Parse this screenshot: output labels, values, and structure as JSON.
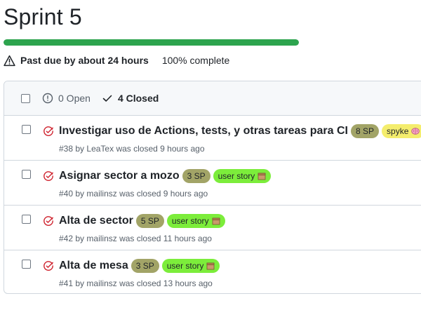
{
  "milestone": {
    "title": "Sprint 5",
    "progress_percent": 100,
    "progress_color": "#2da44e",
    "due_text": "Past due by about 24 hours",
    "complete_text": "100% complete"
  },
  "list_header": {
    "open_text": "0 Open",
    "closed_text": "4 Closed"
  },
  "issues": [
    {
      "title": "Investigar uso de Actions, tests, y otras tareas para CI",
      "labels": [
        {
          "text": "8 SP",
          "bg": "#a2a467",
          "icon": null
        },
        {
          "text": "spyke",
          "bg": "#f4ed6d",
          "icon": "brain-icon"
        }
      ],
      "number": "#38",
      "by": "by",
      "author": "LeaTex",
      "status_text": "was closed 9 hours ago"
    },
    {
      "title": "Asignar sector a mozo",
      "labels": [
        {
          "text": "3 SP",
          "bg": "#a2a467",
          "icon": null
        },
        {
          "text": "user story",
          "bg": "#7ced3b",
          "icon": "box-icon"
        }
      ],
      "number": "#40",
      "by": "by",
      "author": "mailinsz",
      "status_text": "was closed 9 hours ago"
    },
    {
      "title": "Alta de sector",
      "labels": [
        {
          "text": "5 SP",
          "bg": "#a2a467",
          "icon": null
        },
        {
          "text": "user story",
          "bg": "#7ced3b",
          "icon": "box-icon"
        }
      ],
      "number": "#42",
      "by": "by",
      "author": "mailinsz",
      "status_text": "was closed 11 hours ago"
    },
    {
      "title": "Alta de mesa",
      "labels": [
        {
          "text": "3 SP",
          "bg": "#a2a467",
          "icon": null
        },
        {
          "text": "user story",
          "bg": "#7ced3b",
          "icon": "box-icon"
        }
      ],
      "number": "#41",
      "by": "by",
      "author": "mailinsz",
      "status_text": "was closed 13 hours ago"
    }
  ]
}
